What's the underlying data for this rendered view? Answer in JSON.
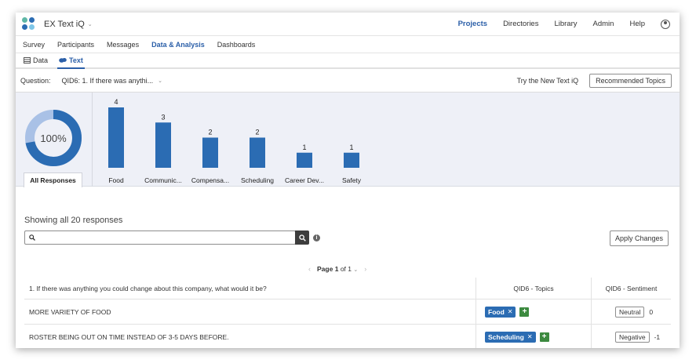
{
  "app": {
    "name": "EX Text iQ"
  },
  "top_nav": [
    "Projects",
    "Directories",
    "Library",
    "Admin",
    "Help"
  ],
  "sub_nav": [
    "Survey",
    "Participants",
    "Messages",
    "Data & Analysis",
    "Dashboards"
  ],
  "view_tabs": [
    "Data",
    "Text"
  ],
  "question": {
    "label": "Question:",
    "value": "QID6: 1. If there was anythi...",
    "try_link": "Try the New Text iQ",
    "recommended_button": "Recommended Topics"
  },
  "donut": {
    "label": "100%",
    "fraction": 1.0,
    "tab": "All Responses",
    "colors": {
      "ring": "#2b6cb3",
      "inner": "#a9c1e6"
    }
  },
  "chart_data": {
    "type": "bar",
    "categories": [
      "Food",
      "Communic...",
      "Compensa...",
      "Scheduling",
      "Career Dev...",
      "Safety"
    ],
    "values": [
      4,
      3,
      2,
      2,
      1,
      1
    ],
    "color": "#2b6cb3",
    "data_labels": true
  },
  "responses": {
    "showing": "Showing all 20 responses",
    "apply_button": "Apply Changes",
    "pager": {
      "prefix": "Page",
      "page": "1",
      "of": "of 1"
    }
  },
  "table": {
    "headers": [
      "1. If there was anything you could change about this company, what would it be?",
      "QID6 - Topics",
      "QID6 - Sentiment"
    ],
    "rows": [
      {
        "text": "MORE VARIETY OF FOOD",
        "topic": "Food",
        "sentiment": "Neutral",
        "score": "0"
      },
      {
        "text": "ROSTER BEING OUT ON TIME INSTEAD OF 3-5 DAYS BEFORE.",
        "topic": "Scheduling",
        "sentiment": "Negative",
        "score": "-1"
      }
    ]
  }
}
